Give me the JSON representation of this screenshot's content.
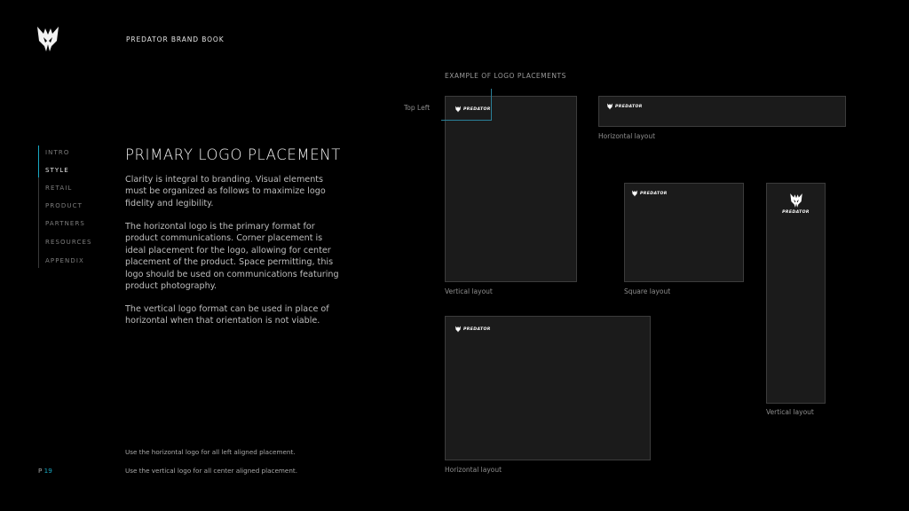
{
  "header": {
    "brand_book": "PREDATOR BRAND BOOK"
  },
  "nav": {
    "items": [
      {
        "label": "INTRO"
      },
      {
        "label": "STYLE"
      },
      {
        "label": "RETAIL"
      },
      {
        "label": "PRODUCT"
      },
      {
        "label": "PARTNERS"
      },
      {
        "label": "RESOURCES"
      },
      {
        "label": "APPENDIX"
      }
    ],
    "active": "STYLE"
  },
  "main": {
    "title": "PRIMARY LOGO PLACEMENT",
    "paragraphs": [
      "Clarity is integral to branding. Visual elements must be organized as follows to maximize logo fidelity and legibility.",
      "The horizontal logo is the primary format for product communications. Corner placement is ideal placement for the logo, allowing for center placement of the product. Space permitting, this logo should be used on communications featuring product photography.",
      "The vertical logo format can be used in place of horizontal when that orientation is not viable."
    ],
    "notes": [
      "Use the horizontal logo for all left aligned placement.",
      "Use the vertical logo for all center aligned placement."
    ]
  },
  "page": {
    "prefix": "P",
    "number": "19"
  },
  "examples": {
    "title": "EXAMPLE OF LOGO PLACEMENTS",
    "callout": "Top Left",
    "logo_text": "PREDATOR",
    "captions": {
      "vertical_tall": "Vertical layout",
      "horizontal_wide": "Horizontal layout",
      "square": "Square layout",
      "horizontal_large": "Horizontal layout",
      "vertical_narrow": "Vertical layout"
    }
  },
  "colors": {
    "accent": "#18a9c4",
    "background": "#000000",
    "panel": "#1b1b1b"
  },
  "icons": {
    "brand": "predator-logo-icon"
  }
}
